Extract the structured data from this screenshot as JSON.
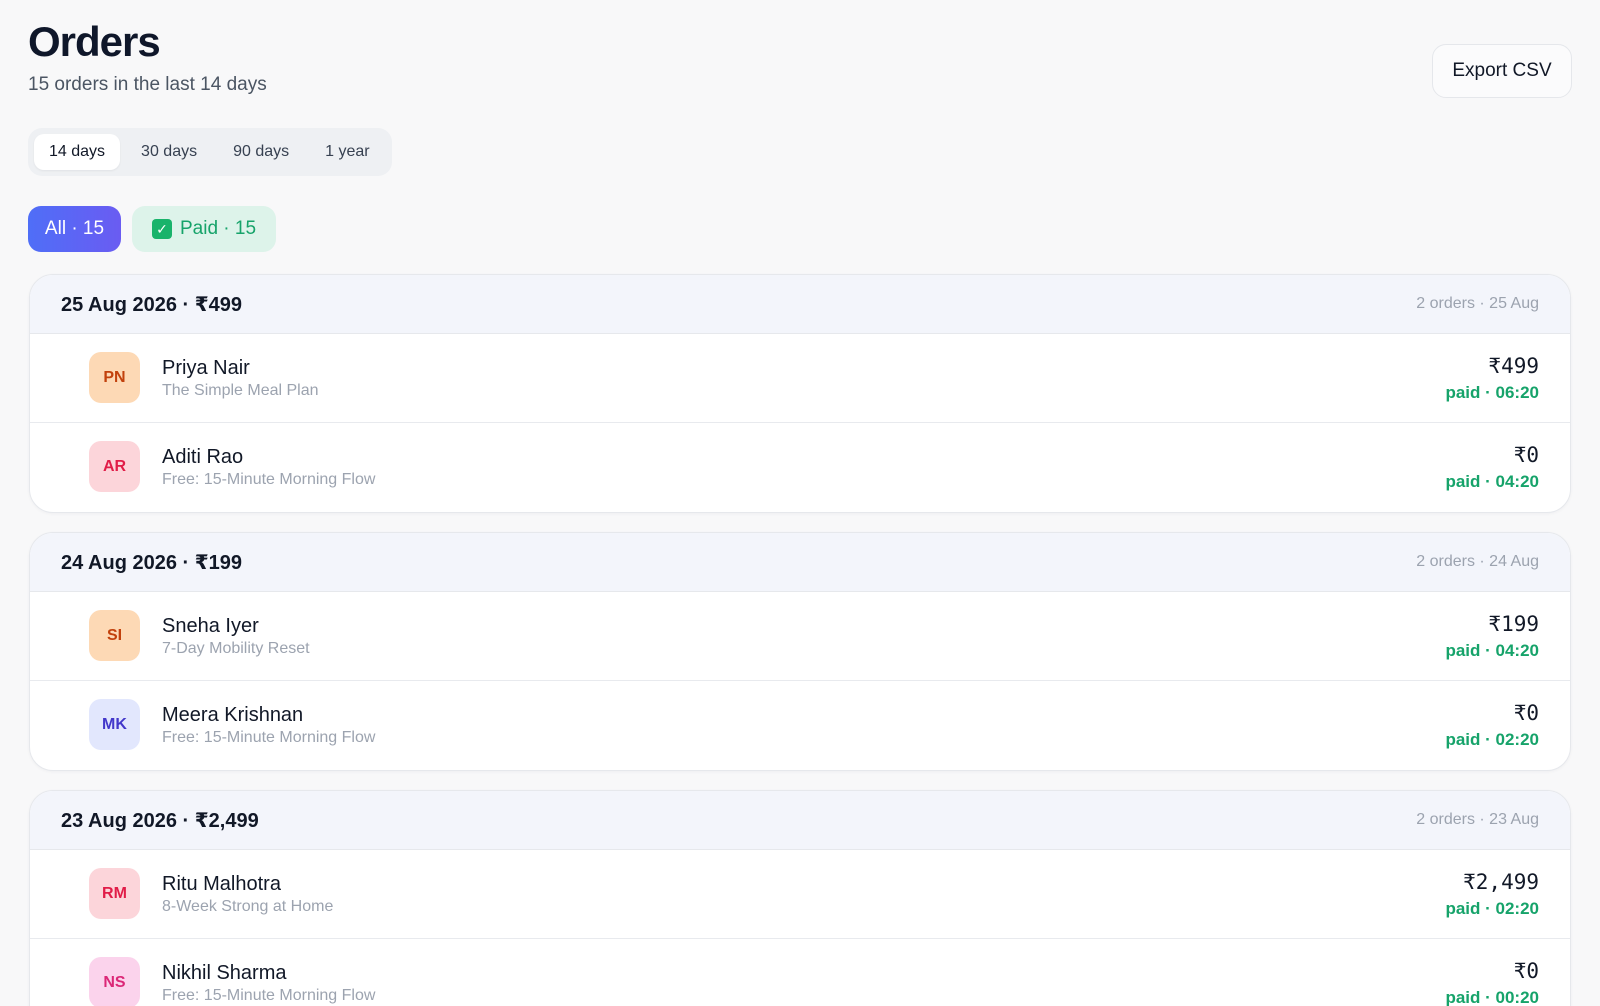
{
  "header": {
    "title": "Orders",
    "subtitle": "15 orders in the last 14 days",
    "export_label": "Export CSV"
  },
  "range_tabs": [
    {
      "label": "14 days",
      "active": true
    },
    {
      "label": "30 days",
      "active": false
    },
    {
      "label": "90 days",
      "active": false
    },
    {
      "label": "1 year",
      "active": false
    }
  ],
  "filters": {
    "all_label": "All · 15",
    "paid_label": "Paid · 15",
    "paid_icon": "check-icon"
  },
  "colors": {
    "accent_start": "#4f6ef7",
    "accent_end": "#6a5cf2",
    "paid_green": "#16a36a"
  },
  "groups": [
    {
      "title": "25 Aug 2026 · ₹499",
      "meta": "2 orders · 25 Aug",
      "orders": [
        {
          "initials": "PN",
          "name": "Priya Nair",
          "product": "The Simple Meal Plan",
          "amount": "₹499",
          "status": "paid · 06:20",
          "avatar_bg": "#fdd9b5",
          "avatar_fg": "#c2410c"
        },
        {
          "initials": "AR",
          "name": "Aditi Rao",
          "product": "Free: 15‑Minute Morning Flow",
          "amount": "₹0",
          "status": "paid · 04:20",
          "avatar_bg": "#fcd5da",
          "avatar_fg": "#e11d48"
        }
      ]
    },
    {
      "title": "24 Aug 2026 · ₹199",
      "meta": "2 orders · 24 Aug",
      "orders": [
        {
          "initials": "SI",
          "name": "Sneha Iyer",
          "product": "7‑Day Mobility Reset",
          "amount": "₹199",
          "status": "paid · 04:20",
          "avatar_bg": "#fdd9b5",
          "avatar_fg": "#c2410c"
        },
        {
          "initials": "MK",
          "name": "Meera Krishnan",
          "product": "Free: 15‑Minute Morning Flow",
          "amount": "₹0",
          "status": "paid · 02:20",
          "avatar_bg": "#e2e7fd",
          "avatar_fg": "#4338ca"
        }
      ]
    },
    {
      "title": "23 Aug 2026 · ₹2,499",
      "meta": "2 orders · 23 Aug",
      "orders": [
        {
          "initials": "RM",
          "name": "Ritu Malhotra",
          "product": "8‑Week Strong at Home",
          "amount": "₹2,499",
          "status": "paid · 02:20",
          "avatar_bg": "#fcd5da",
          "avatar_fg": "#e11d48"
        },
        {
          "initials": "NS",
          "name": "Nikhil Sharma",
          "product": "Free: 15‑Minute Morning Flow",
          "amount": "₹0",
          "status": "paid · 00:20",
          "avatar_bg": "#fbd3ec",
          "avatar_fg": "#db2777"
        }
      ]
    }
  ]
}
